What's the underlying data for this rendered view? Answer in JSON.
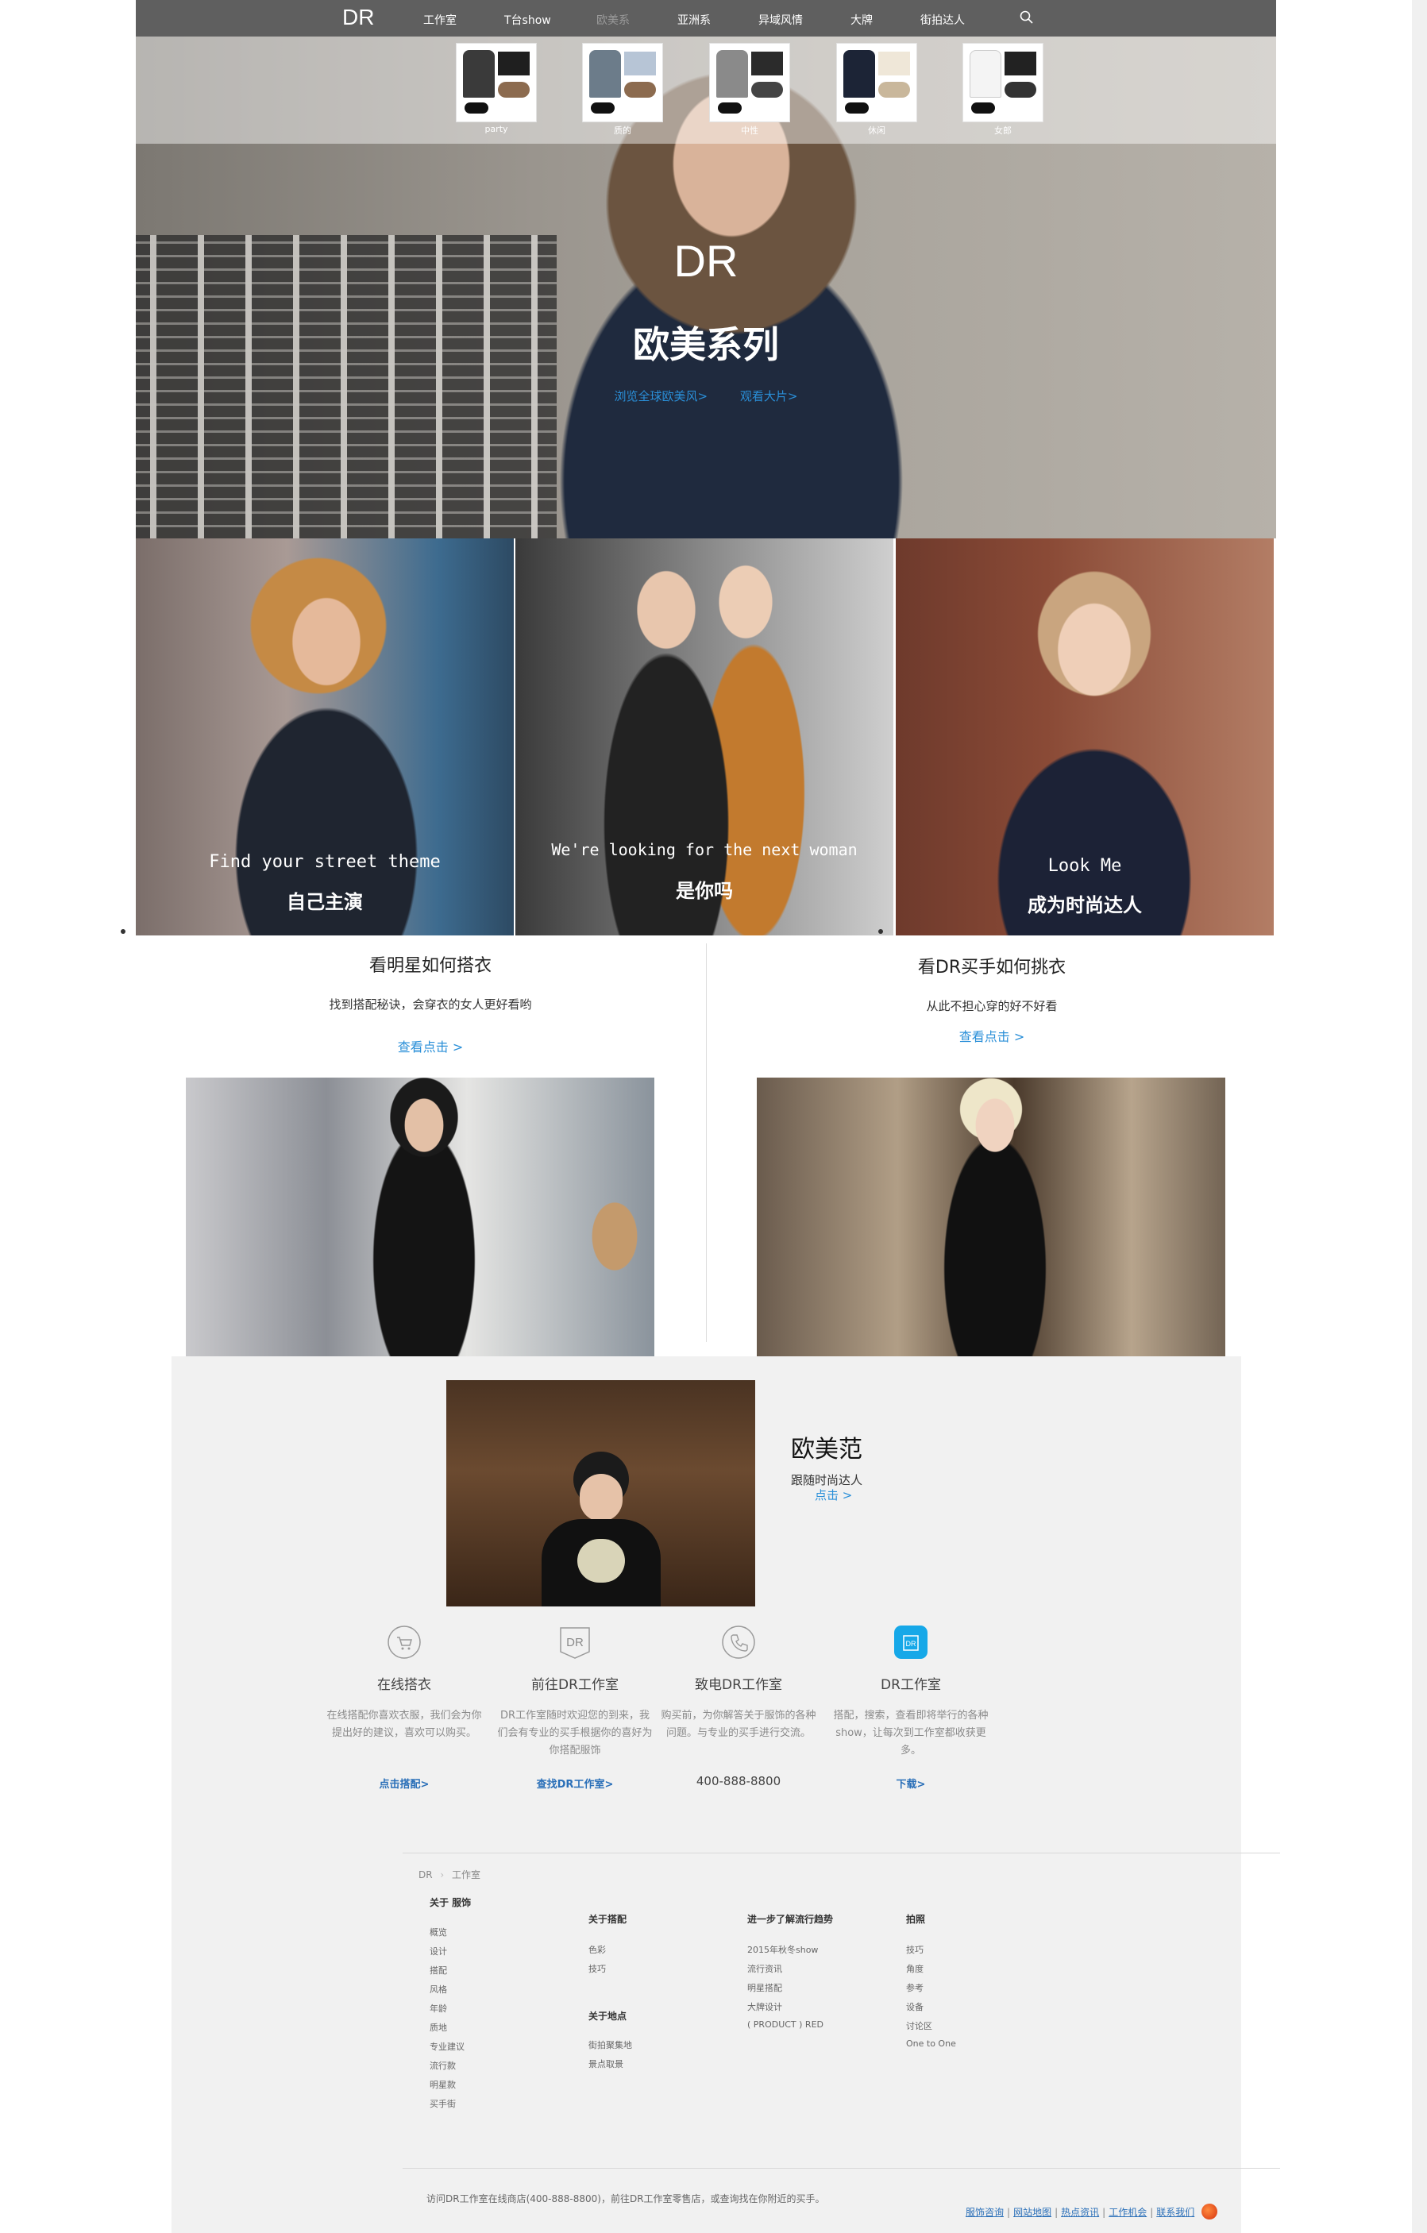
{
  "nav": {
    "logo": "DR",
    "items": [
      "工作室",
      "T台show",
      "欧美系",
      "亚洲系",
      "异域风情",
      "大牌",
      "街拍达人"
    ],
    "active_index": 2,
    "search_icon": "search-icon"
  },
  "hero": {
    "thumbs": [
      "party",
      "质的",
      "中性",
      "休闲",
      "女郎"
    ],
    "logo": "DR",
    "title": "欧美系列",
    "links": [
      "浏览全球欧美风>",
      "观看大片>"
    ]
  },
  "tiles": [
    {
      "line1": "Find your street theme",
      "line2": "自己主演"
    },
    {
      "line1": "We're looking for the next woman",
      "line2": "是你吗"
    },
    {
      "line1": "Look Me",
      "line2": "成为时尚达人"
    }
  ],
  "columns": [
    {
      "title": "看明星如何搭衣",
      "subtitle": "找到搭配秘诀，会穿衣的女人更好看哟",
      "link": "查看点击 >"
    },
    {
      "title": "看DR买手如何挑衣",
      "subtitle": "从此不担心穿的好不好看",
      "link": "查看点击 >"
    }
  ],
  "feature": {
    "title": "欧美范",
    "subtitle": "跟随时尚达人",
    "link": "点击 >"
  },
  "services": [
    {
      "icon": "cart-icon",
      "title": "在线搭衣",
      "desc": "在线搭配你喜欢衣服，我们会为你提出好的建议，喜欢可以购买。",
      "link": "点击搭配>"
    },
    {
      "icon": "dr-logo-icon",
      "title": "前往DR工作室",
      "desc": "DR工作室随时欢迎您的到来，我们会有专业的买手根据你的喜好为你搭配服饰",
      "link": "查找DR工作室>"
    },
    {
      "icon": "phone-icon",
      "title": "致电DR工作室",
      "desc": "购买前，为你解答关于服饰的各种问题。与专业的买手进行交流。",
      "phone": "400-888-8800"
    },
    {
      "icon": "app-icon",
      "title": "DR工作室",
      "desc": "搭配，搜索，查看即将举行的各种show，让每次到工作室都收获更多。",
      "link": "下载>"
    }
  ],
  "footer": {
    "breadcrumb": [
      "DR",
      "工作室"
    ],
    "columns": [
      {
        "head": "关于 服饰",
        "items": [
          "概览",
          "设计",
          "搭配",
          "风格",
          "年龄",
          "质地",
          "专业建议",
          "流行款",
          "明星款",
          "买手街"
        ]
      },
      {
        "head": "关于搭配",
        "items": [
          "色彩",
          "技巧"
        ],
        "head2": "关于地点",
        "items2": [
          "街拍聚集地",
          "景点取景"
        ]
      },
      {
        "head": "进一步了解流行趋势",
        "items": [
          "2015年秋冬show",
          "流行资讯",
          "明星搭配",
          "大牌设计",
          "( PRODUCT ) RED"
        ]
      },
      {
        "head": "拍照",
        "items": [
          "技巧",
          "角度",
          "参考",
          "设备",
          "讨论区",
          "One to One"
        ]
      }
    ],
    "note": "访问DR工作室在线商店(400-888-8800)，前往DR工作室零售店，或查询找在你附近的买手。",
    "links": [
      "服饰咨询",
      "网站地图",
      "热点资讯",
      "工作机会",
      "联系我们"
    ]
  },
  "colors": {
    "nav_bg": "#5f5f5f",
    "link_blue": "#2a8fd8",
    "grey_bg": "#f1f1f1"
  }
}
